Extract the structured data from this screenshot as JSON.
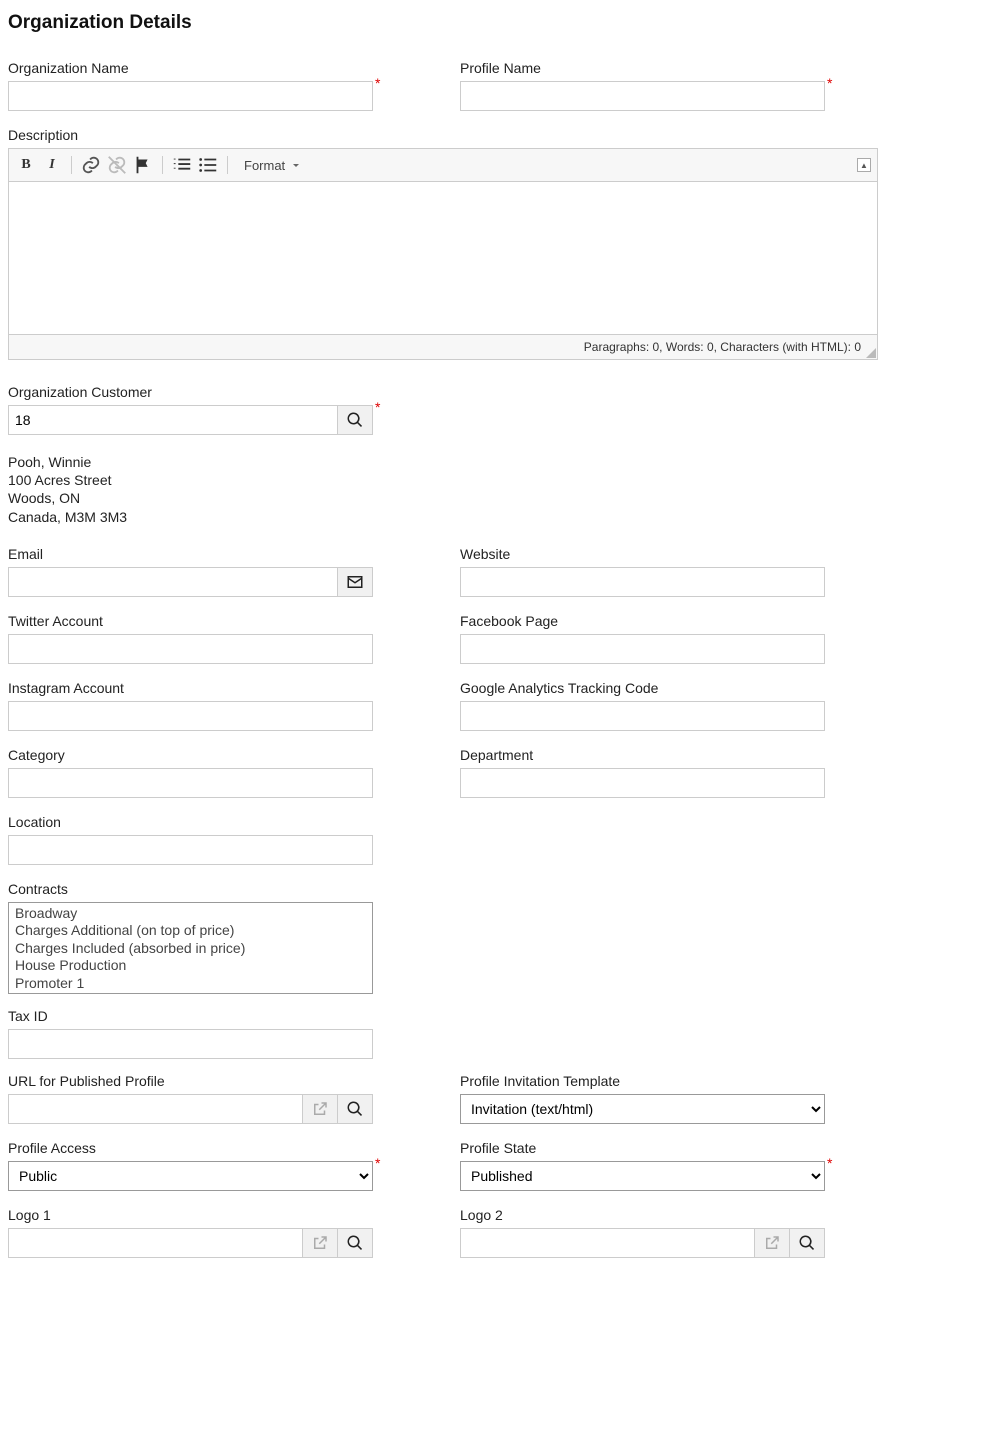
{
  "page_title": "Organization Details",
  "required_mark": "*",
  "fields": {
    "org_name": {
      "label": "Organization Name",
      "value": ""
    },
    "profile_name": {
      "label": "Profile Name",
      "value": ""
    },
    "description": {
      "label": "Description"
    },
    "org_customer": {
      "label": "Organization Customer",
      "value": "18"
    },
    "email": {
      "label": "Email",
      "value": ""
    },
    "website": {
      "label": "Website",
      "value": ""
    },
    "twitter": {
      "label": "Twitter Account",
      "value": ""
    },
    "facebook": {
      "label": "Facebook Page",
      "value": ""
    },
    "instagram": {
      "label": "Instagram Account",
      "value": ""
    },
    "ga_code": {
      "label": "Google Analytics Tracking Code",
      "value": ""
    },
    "category": {
      "label": "Category",
      "value": ""
    },
    "department": {
      "label": "Department",
      "value": ""
    },
    "location": {
      "label": "Location",
      "value": ""
    },
    "contracts": {
      "label": "Contracts"
    },
    "tax_id": {
      "label": "Tax ID",
      "value": ""
    },
    "url_profile": {
      "label": "URL for Published Profile",
      "value": ""
    },
    "invitation_tpl": {
      "label": "Profile Invitation Template",
      "value": "Invitation (text/html)"
    },
    "profile_access": {
      "label": "Profile Access",
      "value": "Public"
    },
    "profile_state": {
      "label": "Profile State",
      "value": "Published"
    },
    "logo1": {
      "label": "Logo 1",
      "value": ""
    },
    "logo2": {
      "label": "Logo 2",
      "value": ""
    }
  },
  "editor": {
    "format_label": "Format",
    "status": "Paragraphs: 0, Words: 0, Characters (with HTML): 0",
    "toolbar": {
      "bold": "B",
      "italic": "I"
    }
  },
  "customer": {
    "name": "Pooh, Winnie",
    "street": "100 Acres Street",
    "city": "Woods, ON",
    "country": "Canada, M3M 3M3"
  },
  "contracts_options": [
    "Broadway",
    "Charges Additional (on top of price)",
    "Charges Included (absorbed in price)",
    "House Production",
    "Promoter 1"
  ],
  "invitation_options": [
    "Invitation (text/html)"
  ],
  "access_options": [
    "Public"
  ],
  "state_options": [
    "Published"
  ]
}
